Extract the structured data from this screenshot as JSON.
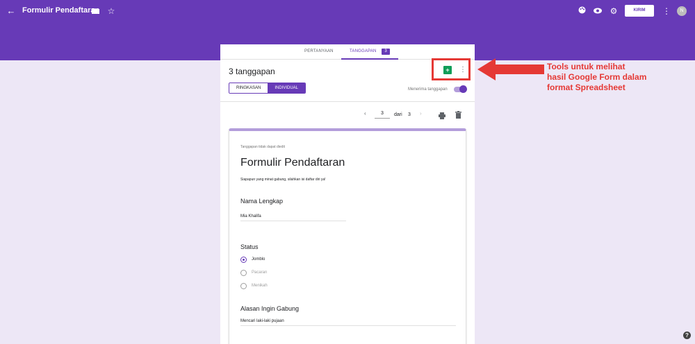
{
  "topbar": {
    "title": "Formulir Pendaftaran",
    "send_label": "KIRIM",
    "avatar_initial": "N",
    "color": "#673ab7",
    "icons": [
      "back-arrow-icon",
      "folder-icon",
      "star-icon",
      "palette-icon",
      "preview-eye-icon",
      "settings-gear-icon",
      "more-vert-icon"
    ]
  },
  "tabs": {
    "questions": "PERTANYAAN",
    "responses": "TANGGAPAN",
    "responses_badge": "3"
  },
  "responses": {
    "count_title": "3 tanggapan",
    "summary": "RINGKASAN",
    "individual": "INDIVIDUAL",
    "accepting": "Menerima tanggapan"
  },
  "pager": {
    "current": "3",
    "of_label": "dari",
    "total": "3"
  },
  "form": {
    "note": "Tanggapan tidak dapat diedit",
    "title": "Formulir Pendaftaran",
    "description": "Siapapun yang minat gabung, silahkan isi daftar diri ya!",
    "q1_label": "Nama Lengkap",
    "q1_answer": "Mia Khalifa",
    "q2_label": "Status",
    "q2_options": [
      "Jomblo",
      "Pacaran",
      "Menikah"
    ],
    "q2_selected": "Jomblo",
    "q3_label": "Alasan Ingin Gabung",
    "q3_answer": "Mencari laki-laki pujaan"
  },
  "annotation": {
    "line1": "Tools untuk melihat",
    "line2": "hasil Google Form dalam",
    "line3": "format Spreadsheet",
    "color": "#e53935"
  }
}
